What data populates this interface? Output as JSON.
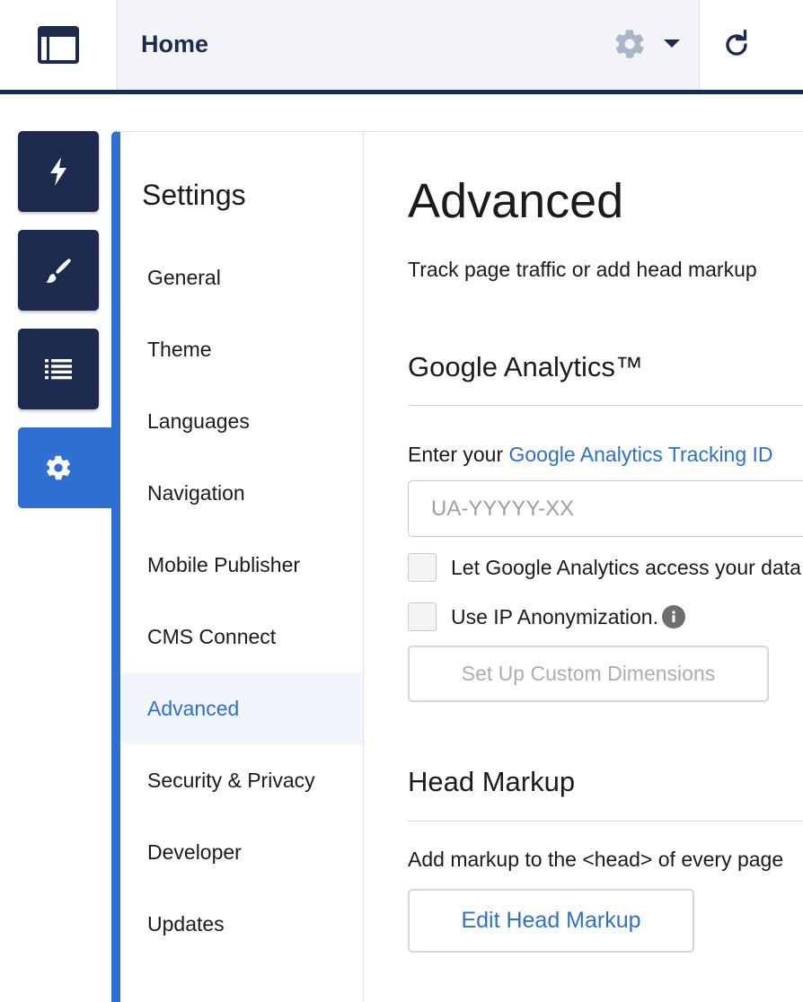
{
  "topbar": {
    "page_title": "Home",
    "logo_icon": "layout-icon",
    "page_settings_icon": "gear-icon",
    "page_menu_icon": "caret-down-icon",
    "refresh_icon": "refresh-icon"
  },
  "rail": {
    "items": [
      {
        "icon": "lightning-icon",
        "active": false
      },
      {
        "icon": "paintbrush-icon",
        "active": false
      },
      {
        "icon": "list-icon",
        "active": false
      },
      {
        "icon": "gear-icon",
        "active": true
      }
    ]
  },
  "settings": {
    "heading": "Settings",
    "items": [
      {
        "label": "General"
      },
      {
        "label": "Theme"
      },
      {
        "label": "Languages"
      },
      {
        "label": "Navigation"
      },
      {
        "label": "Mobile Publisher"
      },
      {
        "label": "CMS Connect"
      },
      {
        "label": "Advanced",
        "active": true
      },
      {
        "label": "Security & Privacy"
      },
      {
        "label": "Developer"
      },
      {
        "label": "Updates"
      }
    ]
  },
  "content": {
    "title": "Advanced",
    "description": "Track page traffic or add head markup",
    "google_analytics": {
      "heading": "Google Analytics™",
      "prompt_prefix": "Enter your ",
      "prompt_link": "Google Analytics Tracking ID",
      "input_placeholder": "UA-YYYYY-XX",
      "input_value": "",
      "checkbox_access_label": "Let Google Analytics access your data",
      "checkbox_ip_label": "Use IP Anonymization.",
      "checkbox_access_checked": false,
      "checkbox_ip_checked": false,
      "custom_dimensions_button": "Set Up Custom Dimensions"
    },
    "head_markup": {
      "heading": "Head Markup",
      "description": "Add markup to the <head> of every page",
      "edit_button": "Edit Head Markup"
    }
  },
  "colors": {
    "navy": "#1c2b4d",
    "accent": "#2e6fd1",
    "active_bg": "#f1f6fc"
  }
}
